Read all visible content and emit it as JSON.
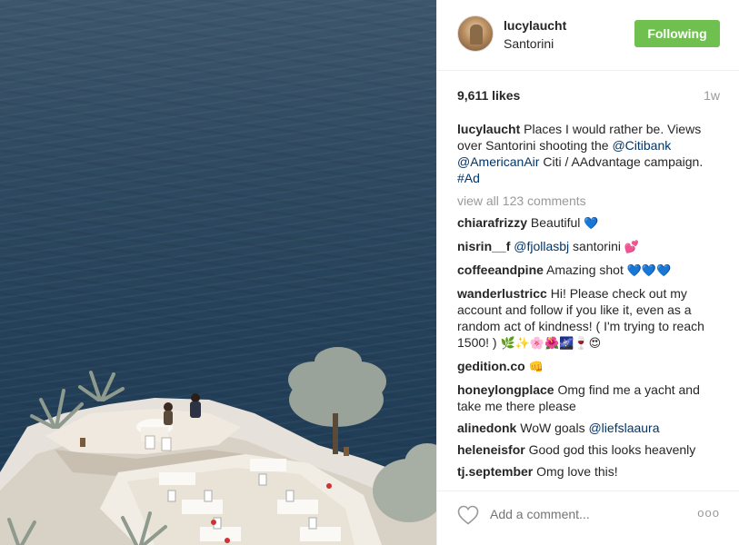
{
  "post": {
    "username": "lucylaucht",
    "location": "Santorini",
    "follow_label": "Following",
    "likes": "9,611 likes",
    "age": "1w",
    "caption": {
      "user": "lucylaucht",
      "text_1": " Places I would rather be. Views over Santorini shooting the ",
      "mention_1": "@Citibank",
      "mention_2": "@AmericanAir",
      "text_2": " Citi / AAdvantage campaign. ",
      "hashtag": "#Ad"
    },
    "view_all": "view all 123 comments",
    "comments": [
      {
        "user": "chiarafrizzy",
        "text": " Beautiful ",
        "emoji": "💙"
      },
      {
        "user": "nisrin__f",
        "mention": "@fjollasbj",
        "text": " santorini ",
        "emoji": "💕"
      },
      {
        "user": "coffeeandpine",
        "text": " Amazing shot ",
        "emoji": "💙💙💙"
      },
      {
        "user": "wanderlustricc",
        "text": " Hi! Please check out my account and follow if you like it, even as a random act of kindness! ( I'm trying to reach 1500! ) ",
        "emoji": "🌿✨🌸🌺🌌🍷😍"
      },
      {
        "user": "gedition.co",
        "text": " ",
        "emoji": "👊"
      },
      {
        "user": "honeylongplace",
        "text": " Omg find me a yacht and take me there please"
      },
      {
        "user": "alinedonk",
        "text": " WoW goals ",
        "mention": "@liefslaaura"
      },
      {
        "user": "heleneisfor",
        "text": " Good god this looks heavenly"
      },
      {
        "user": "tj.september",
        "text": " Omg love this!"
      }
    ],
    "add_comment_placeholder": "Add a comment...",
    "more_label": "ooo",
    "colors": {
      "follow": "#70c050",
      "mention": "#003569",
      "muted": "#999999"
    }
  }
}
